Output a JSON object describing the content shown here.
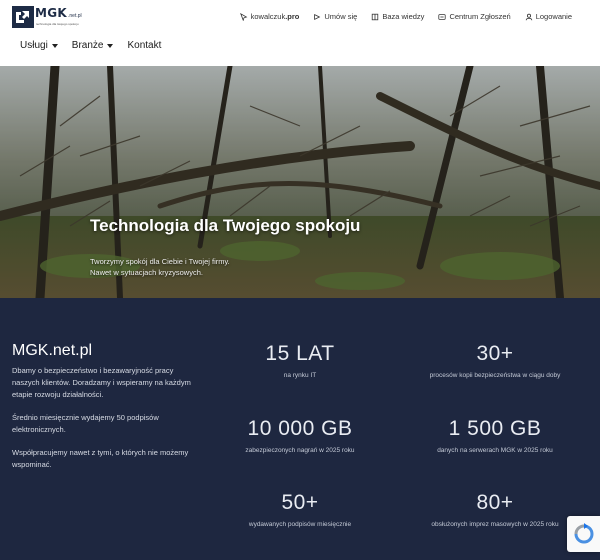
{
  "brand": {
    "name": "MGK",
    "suffix": ".net.pl",
    "tagline": "technologia dla twojego spokoju"
  },
  "toplinks": [
    {
      "icon": "cursor-icon",
      "label": "kowalczuk",
      "label_bold": ".pro"
    },
    {
      "icon": "arrow-icon",
      "label": "Umów się"
    },
    {
      "icon": "book-icon",
      "label": "Baza wiedzy"
    },
    {
      "icon": "ticket-icon",
      "label": "Centrum Zgłoszeń"
    },
    {
      "icon": "user-icon",
      "label": "Logowanie"
    }
  ],
  "nav": [
    {
      "label": "Usługi",
      "dropdown": true
    },
    {
      "label": "Branże",
      "dropdown": true
    },
    {
      "label": "Kontakt",
      "dropdown": false
    }
  ],
  "hero": {
    "title": "Technologia dla Twojego spokoju",
    "subtitle_line1": "Tworzymy spokój dla Ciebie i Twojej firmy.",
    "subtitle_line2": "Nawet w sytuacjach kryzysowych."
  },
  "about": {
    "title": "MGK.net.pl",
    "paragraphs": [
      "Dbamy o bezpieczeństwo i bezawaryjność pracy naszych klientów. Doradzamy i wspieramy na każdym etapie rozwoju działalności.",
      "Średnio miesięcznie wydajemy 50 podpisów elektronicznych.",
      "Współpracujemy nawet z tymi, o których nie możemy wspominać."
    ]
  },
  "stats": [
    {
      "value": "15 LAT",
      "label": "na rynku IT"
    },
    {
      "value": "30+",
      "label": "procesów kopii bezpieczeństwa w ciągu doby"
    },
    {
      "value": "10 000 GB",
      "label": "zabezpieczonych nagrań w 2025 roku"
    },
    {
      "value": "1 500 GB",
      "label": "danych na serwerach MGK w 2025 roku"
    },
    {
      "value": "50+",
      "label": "wydawanych podpisów miesięcznie"
    },
    {
      "value": "80+",
      "label": "obsłużonych imprez masowych w 2025 roku"
    }
  ],
  "colors": {
    "dark_section": "#1e2740",
    "brand": "#1d2b45"
  }
}
